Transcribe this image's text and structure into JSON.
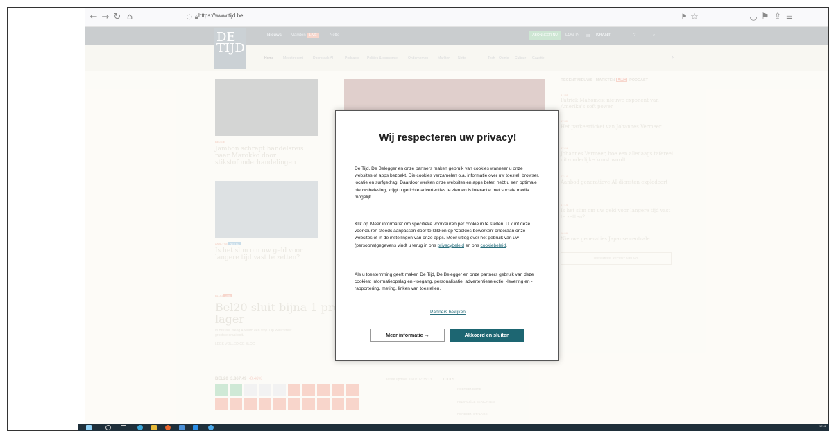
{
  "browser": {
    "url": "https://www.tijd.be"
  },
  "site": {
    "logo_line1": "DE",
    "logo_line2": "TIJD",
    "nav_links": [
      "Nieuws",
      "Markten",
      "Netto"
    ],
    "live_badge": "LIVE",
    "subnav": [
      "Home",
      "Meest recent",
      "Doorbraak AI",
      "Podcasts",
      "Politiek & economie",
      "Ondernemen",
      "Markten",
      "Netto",
      "Tech",
      "Opinie",
      "Cultuur",
      "Gazette"
    ],
    "abonneer": "ABONNEER NU",
    "login": "LOG IN",
    "krant": "KRANT",
    "articles": {
      "a1_tag": "BELGIË",
      "a1_title": "Jambon schrapt handelsreis naar Marokko door stikstofonderhandelingen",
      "a2_tag": "ANALYSE",
      "a2_badge": "NETTO",
      "a2_title": "Is het slim om uw geld voor langere tijd vast te zetten?",
      "blog_tag": "BLOG",
      "blog_badge": "LIVE",
      "blog_title_1": "Bel20 sluit bijna 1 proc",
      "blog_title_2": "lager",
      "blog_sub_1": "In Brussel kreeg Aperam een stop. Op Wall Street",
      "blog_sub_2": "grootste draai ooit.",
      "blog_link": "LEES VOLLEDIGE BLOG"
    },
    "recent": {
      "tabs": [
        "RECENT NIEUWS",
        "MARKTEN",
        "PODCAST"
      ],
      "tab_badge": "LIVE",
      "items": [
        {
          "time": "17:33",
          "title": "Patrick Mahomes: nieuwe exponent van Amerika's soft power"
        },
        {
          "time": "17:30",
          "title": "Het parkeerticket van Johannes Vermeer"
        },
        {
          "time": "17:24",
          "title": "Johannes Vermeer, hoe een alledaags tafereel uitzonderlijke kunst wordt"
        },
        {
          "time": "17:14",
          "title": "Aanbod generatieve AI-diensten explodeert"
        },
        {
          "time": "17:14",
          "title": "Is het slim om uw geld voor langere tijd vast te zetten?"
        },
        {
          "time": "16:59",
          "title": "Nieuwe generaties Japanse centrale"
        }
      ],
      "more": "LEES MEER RECENT NIEUWS"
    },
    "markets": {
      "index": "BEL20",
      "value": "3.867,49",
      "change": "-0,46%",
      "updated": "Laatste update: 10/02 17:35:13",
      "tools_title": "TOOLS",
      "tools": [
        "KOERSENBORD",
        "FINANCIËLE BERICHTEN",
        "FONDSEN ETALAGE"
      ]
    }
  },
  "modal": {
    "title": "Wij respecteren uw privacy!",
    "p1": "De Tijd, De Belegger en onze partners maken gebruik van cookies wanneer u onze websites of apps bezoekt. Die cookies verzamelen o.a. informatie over uw toestel, browser, locatie en surfgedrag. Daardoor werken onze websites en apps beter, hebt u een optimale nieuwsbeleving, krijgt u gerichte advertenties te zien en is interactie met sociale media mogelijk.",
    "p2_pre": "Klik op 'Meer informatie' om specifieke voorkeuren per cookie in te stellen. U kunt deze voorkeuren steeds aanpassen door te klikken op 'Cookies bewerken' onderaan onze websites of in de instellingen van onze apps. Meer uitleg over het gebruik van uw (persoons)gegevens vindt u terug in ons ",
    "privacy_link": "privacybeleid",
    "p2_mid": " en ons ",
    "cookie_link": "cookiebeleid",
    "p2_end": ".",
    "p3": "Als u toestemming geeft maken De Tijd, De Belegger en onze partners gebruik van deze cookies: informatieopslag en -toegang, personalisatie, advertentieselectie, -levering en -rapportering, meting, linken van toestellen.",
    "partners": "Partners bekijken",
    "more_info": "Meer informatie →",
    "accept": "Akkoord en sluiten"
  },
  "taskbar": {
    "time": "17:42"
  }
}
